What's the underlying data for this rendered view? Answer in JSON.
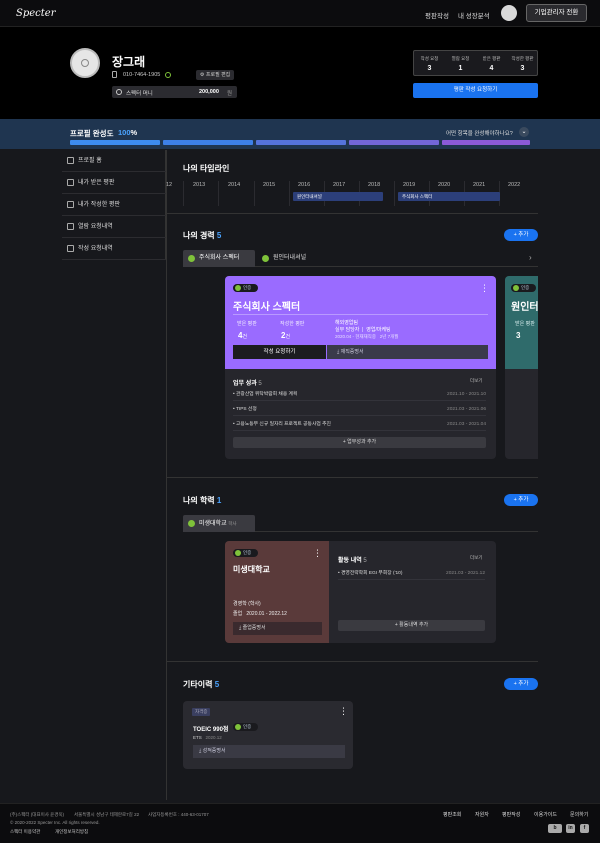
{
  "nav": {
    "logo": "Specter",
    "links": [
      "평판작성",
      "내 성장분석"
    ],
    "switch_button": "기업관리자 전환"
  },
  "profile": {
    "name": "장그래",
    "phone": "010-7464-1905",
    "edit_button": "프로필 편집",
    "coin_label": "스펙터 머니",
    "coin_value": "200,000",
    "coin_unit": "원"
  },
  "stats": [
    {
      "label": "작성 요청",
      "value": "3"
    },
    {
      "label": "열람 요청",
      "value": "1"
    },
    {
      "label": "받은 평판",
      "value": "4"
    },
    {
      "label": "작성한 평판",
      "value": "3"
    }
  ],
  "request_button": "평판 작성 요청하기",
  "completion": {
    "title": "프로필 완성도",
    "percent": "100",
    "unit": "%",
    "question": "어떤 항목을 완성해야하나요?"
  },
  "sidebar": [
    "프로필 홈",
    "내가 받은 평판",
    "내가 작성한 평판",
    "열람 요청내역",
    "작성 요청내역"
  ],
  "timeline": {
    "title": "나의 타임라인",
    "years": [
      "12",
      "2013",
      "2014",
      "2015",
      "2016",
      "2017",
      "2018",
      "2019",
      "2020",
      "2021",
      "2022"
    ],
    "bars": [
      "원인터내셔널",
      "주식회사 스펙터"
    ]
  },
  "career": {
    "title": "나의 경력",
    "count": "5",
    "add": "+ 추가",
    "tabs": [
      "주식회사 스펙터",
      "원인터내셔널"
    ],
    "card": {
      "badge": "인증",
      "company": "주식회사 스펙터",
      "received_label": "받은 평판",
      "received_value": "4",
      "received_unit": "건",
      "written_label": "작성한 평판",
      "written_value": "2",
      "written_unit": "건",
      "dept": "해외영업팀",
      "role": "실무 담당자",
      "role_detail": "영업/마케팅",
      "period": "2020.04 - 현재재직중",
      "duration": "2년 7개월",
      "write_button": "작성 요청하기",
      "proof_button": "재직증명서",
      "perf_title": "업무 성과",
      "perf_count": "5",
      "more": "더보기",
      "perf": [
        {
          "t": "관광산업 위탁박람회 채용 계획",
          "d": "2021.10 - 2021.10"
        },
        {
          "t": "TIPS 선정",
          "d": "2021.03 - 2021.06"
        },
        {
          "t": "고용노동부 신규 일자리 프로젝트 공동사업 추진",
          "d": "2021.03 - 2021.04"
        }
      ],
      "perf_add": "+ 업무성과 추가"
    },
    "card2": {
      "badge": "인증",
      "company": "원인터",
      "received_label": "받은 평판",
      "received_value": "3"
    }
  },
  "education": {
    "title": "나의 학력",
    "count": "1",
    "add": "+ 추가",
    "tab": "미생대학교",
    "tab_sub": "학사",
    "card": {
      "badge": "인증",
      "school": "미생대학교",
      "major": "경영학 (학사)",
      "status": "졸업",
      "period": "2020.01 - 2022.12",
      "proof": "졸업증명서",
      "act_title": "활동 내역",
      "act_count": "5",
      "more": "더보기",
      "act": [
        {
          "t": "경영전략학회 EGI 부회장 ('10)",
          "d": "2021.03 - 2021.12"
        }
      ],
      "act_add": "+ 활동내역 추가"
    }
  },
  "other": {
    "title": "기타이력",
    "count": "5",
    "add": "+ 추가",
    "card": {
      "tag": "자격증",
      "name": "TOEIC 990점",
      "badge": "인증",
      "issuer": "ETS",
      "date": "2020.12",
      "proof": "성적증명서"
    }
  },
  "footer": {
    "company": "(주)스펙터 (대표이사 윤경욱)",
    "address": "서울특별시 성남구 테헤란로7길 22",
    "biz": "사업자등록번호 : 440-63-01707",
    "copyright": "© 2020-2022 Specter Inc. All rights reserved.",
    "terms": "스펙터 이용약관",
    "privacy": "개인정보처리방침",
    "links": [
      "평판조회",
      "자원자",
      "평판작성",
      "이용가이드",
      "문의하기"
    ]
  },
  "colors": {
    "accent": "#1a73f0",
    "card_purple": "#9a6bff",
    "card_teal": "#2f6b6b",
    "card_brown": "#5a3a3a",
    "check": "#7fc23a"
  }
}
